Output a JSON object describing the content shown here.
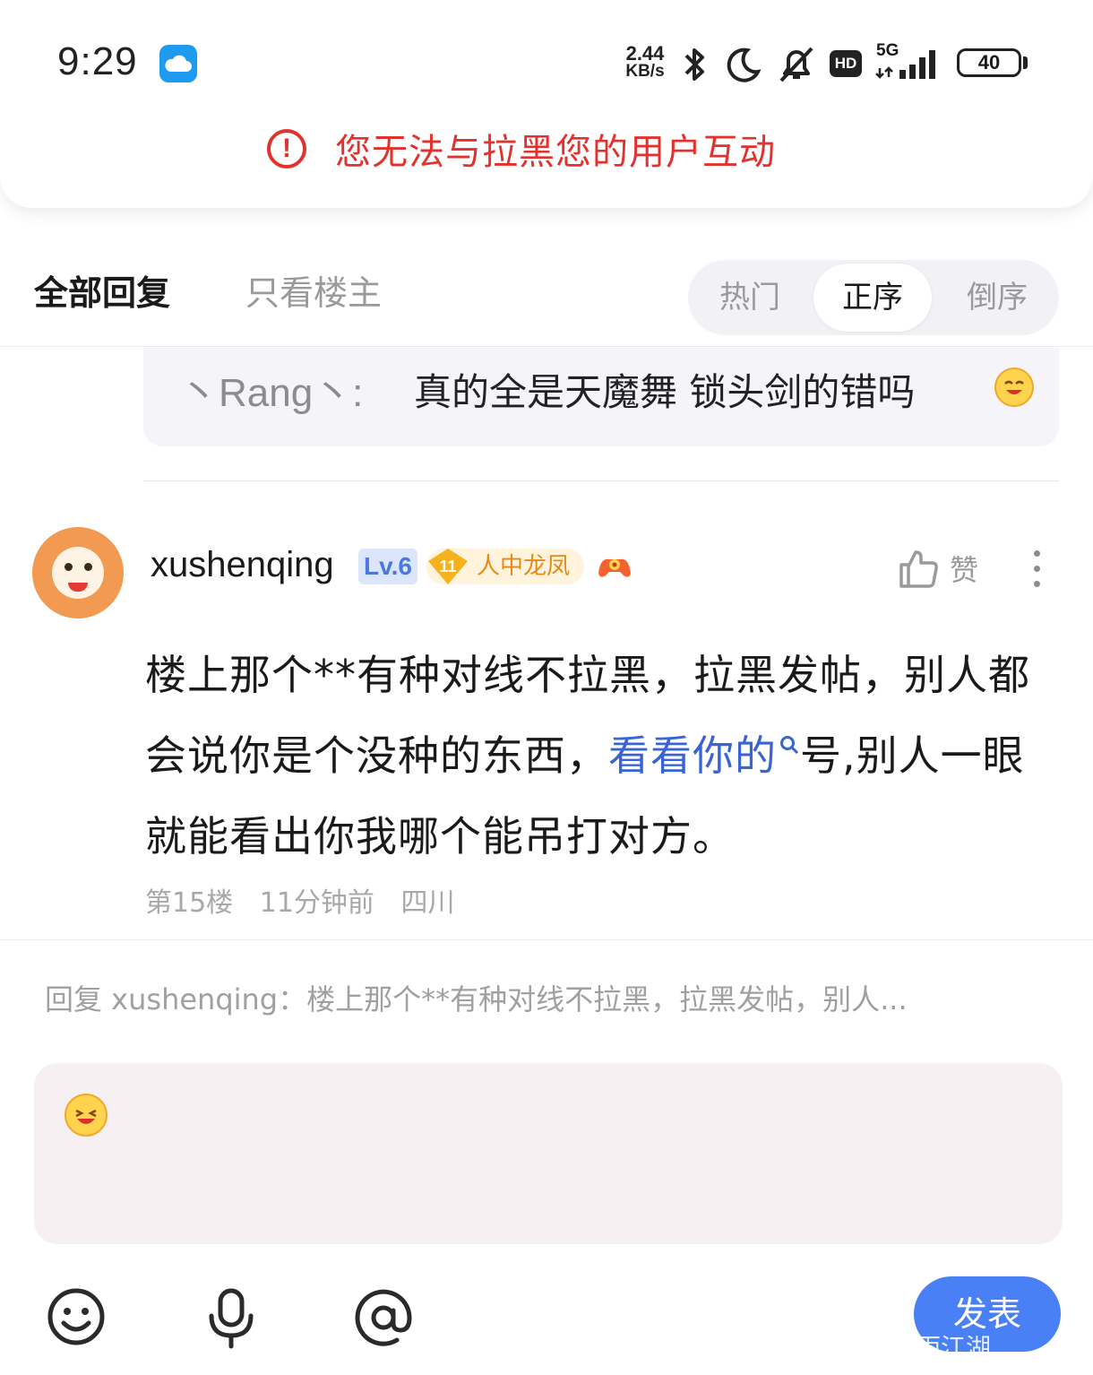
{
  "status_bar": {
    "time": "9:29",
    "net_speed_value": "2.44",
    "net_speed_unit": "KB/s",
    "hd_label": "HD",
    "network_type": "5G",
    "battery": "40"
  },
  "toast": {
    "icon": "!",
    "message": "您无法与拉黑您的用户互动"
  },
  "tabs": {
    "all_replies": "全部回复",
    "only_op": "只看楼主",
    "sort_options": [
      "热门",
      "正序",
      "倒序"
    ],
    "selected_sort": "正序"
  },
  "quote": {
    "author": "丶Rang丶:",
    "text": "真的全是天魔舞 锁头剑的错吗"
  },
  "post": {
    "username": "xushenqing",
    "level": "Lv.6",
    "honor_level": "11",
    "honor_title": "人中龙凤",
    "like_label": "赞",
    "body_before_link": "楼上那个**有种对线不拉黑，拉黑发帖，别人都会说你是个没种的东西，",
    "link_text": "看看你的",
    "body_after_link": "号,别人一眼就能看出你我哪个能吊打对方。",
    "floor": "第15楼",
    "time_ago": "11分钟前",
    "location": "四川"
  },
  "composer": {
    "reply_hint": "回复 xushenqing：楼上那个**有种对线不拉黑，拉黑发帖，别人...",
    "send_label": "发表",
    "watermark": "@烟雨江湖"
  },
  "colors": {
    "error": "#e3312d",
    "link": "#3a63d6",
    "send_button": "#4a80f5",
    "level_badge": "#4a78e0",
    "honor": "#e58a16"
  },
  "icons": [
    "cloud-icon",
    "bluetooth-icon",
    "moon-icon",
    "bell-off-icon",
    "signal-icon",
    "battery-icon",
    "warning-icon",
    "thumbs-up-icon",
    "more-vertical-icon",
    "search-icon",
    "emoji-icon",
    "mic-icon",
    "at-icon",
    "game-icon"
  ]
}
